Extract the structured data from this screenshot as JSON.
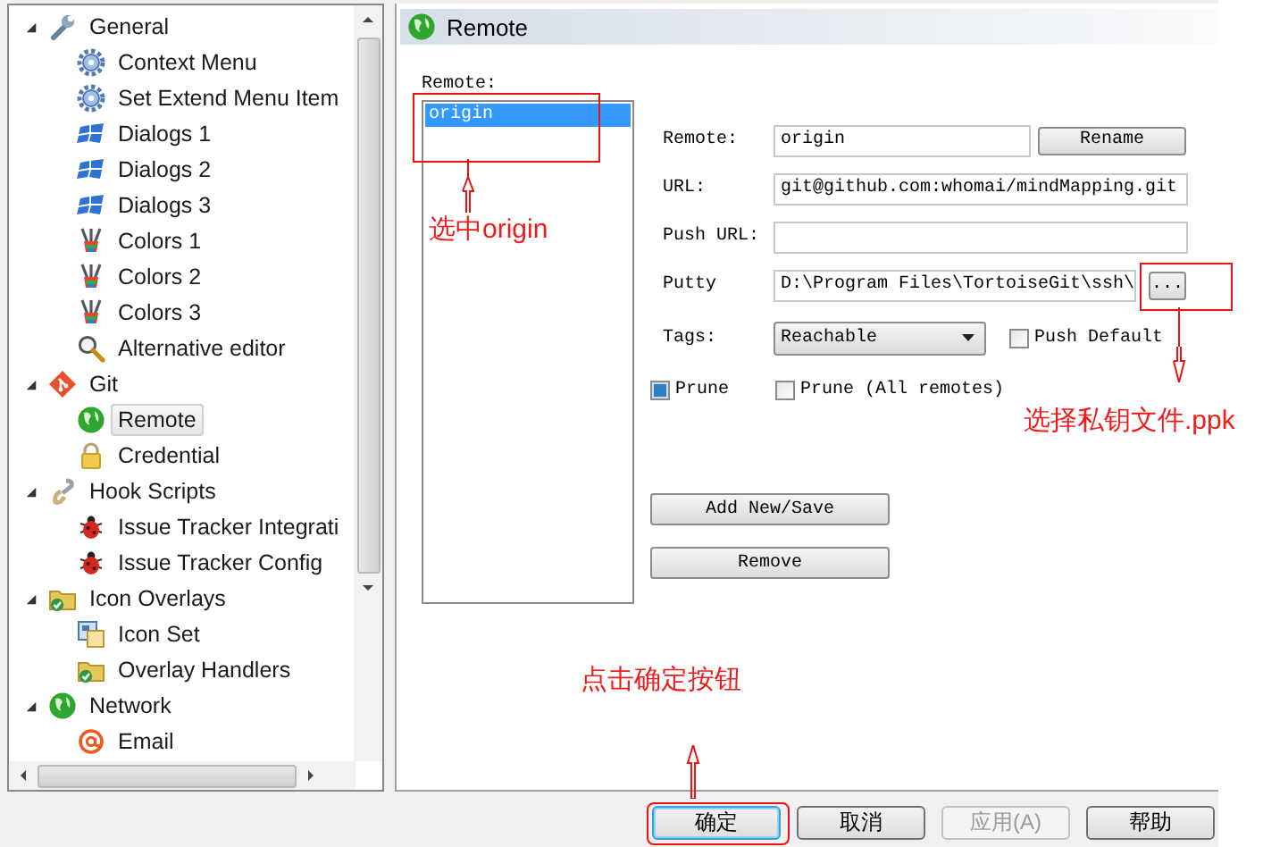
{
  "tree": {
    "items": [
      {
        "label": "General",
        "expanded": true,
        "selected": false,
        "children": [
          {
            "label": "Context Menu",
            "selected": false
          },
          {
            "label": "Set Extend Menu Item",
            "selected": false
          },
          {
            "label": "Dialogs 1",
            "selected": false
          },
          {
            "label": "Dialogs 2",
            "selected": false
          },
          {
            "label": "Dialogs 3",
            "selected": false
          },
          {
            "label": "Colors 1",
            "selected": false
          },
          {
            "label": "Colors 2",
            "selected": false
          },
          {
            "label": "Colors 3",
            "selected": false
          },
          {
            "label": "Alternative editor",
            "selected": false
          }
        ]
      },
      {
        "label": "Git",
        "expanded": true,
        "selected": false,
        "children": [
          {
            "label": "Remote",
            "selected": true
          },
          {
            "label": "Credential",
            "selected": false
          }
        ]
      },
      {
        "label": "Hook Scripts",
        "expanded": true,
        "selected": false,
        "children": [
          {
            "label": "Issue Tracker Integrati",
            "selected": false
          },
          {
            "label": "Issue Tracker Config",
            "selected": false
          }
        ]
      },
      {
        "label": "Icon Overlays",
        "expanded": true,
        "selected": false,
        "children": [
          {
            "label": "Icon Set",
            "selected": false
          },
          {
            "label": "Overlay Handlers",
            "selected": false
          }
        ]
      },
      {
        "label": "Network",
        "expanded": true,
        "selected": false,
        "children": [
          {
            "label": "Email",
            "selected": false
          }
        ]
      }
    ]
  },
  "page": {
    "title": "Remote",
    "list_label": "Remote:",
    "remotes": [
      {
        "label": "origin",
        "selected": true
      }
    ],
    "fields": [
      {
        "label": "Remote:",
        "value": "origin",
        "button": "Rename"
      },
      {
        "label": "URL:",
        "value": "git@github.com:whomai/mindMapping.git"
      },
      {
        "label": "Push URL:"
      },
      {
        "label": "Putty",
        "value": "D:\\Program Files\\TortoiseGit\\ssh\\",
        "button": "..."
      }
    ],
    "tags": {
      "label": "Tags:",
      "value": "Reachable"
    },
    "push_default": {
      "label": "Push Default",
      "checked": false
    },
    "prune": {
      "label": "Prune",
      "checked": true
    },
    "prune_all": {
      "label": "Prune (All remotes)",
      "checked": false
    },
    "actions": [
      "Add New/Save",
      "Remove"
    ]
  },
  "buttons": [
    {
      "label": "确定",
      "focused": true,
      "disabled": false
    },
    {
      "label": "取消",
      "focused": false,
      "disabled": false
    },
    {
      "label": "应用(A)",
      "focused": false,
      "disabled": true
    },
    {
      "label": "帮助",
      "focused": false,
      "disabled": false
    }
  ],
  "annotations": [
    "选中origin",
    "选择私钥文件.ppk",
    "点击确定按钮"
  ]
}
